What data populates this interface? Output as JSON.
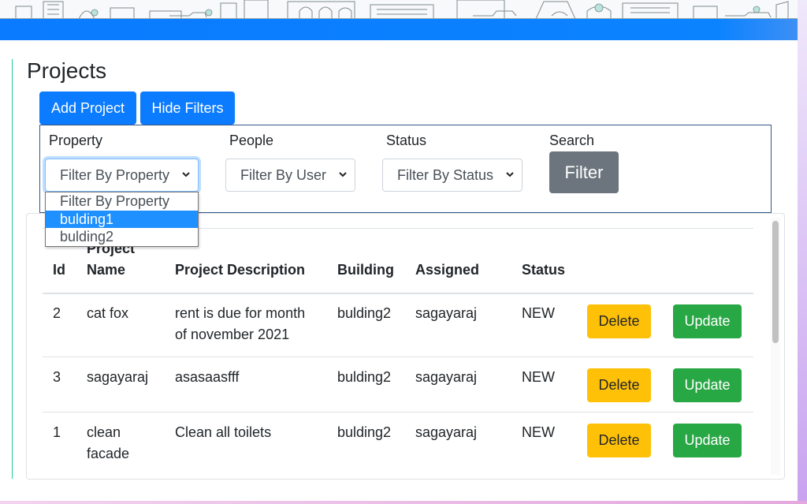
{
  "page": {
    "title": "Projects"
  },
  "toolbar": {
    "add_project_label": "Add Project",
    "hide_filters_label": "Hide Filters"
  },
  "filters": {
    "property_label": "Property",
    "people_label": "People",
    "status_label": "Status",
    "search_label": "Search",
    "property_select_value": "Filter By Property",
    "people_select_value": "Filter By User",
    "status_select_value": "Filter By Status",
    "filter_button_label": "Filter",
    "property_options": [
      "Filter By Property",
      "bulding1",
      "bulding2"
    ],
    "highlighted_option": "bulding1"
  },
  "table": {
    "headers": {
      "id": "Id",
      "name_line1": "Project",
      "name_line2": "Name",
      "description": "Project Description",
      "building": "Building",
      "assigned": "Assigned",
      "status": "Status"
    },
    "rows": [
      {
        "id": "2",
        "name_line1": "cat fox",
        "name_line2": "",
        "desc_line1": "rent is due for month",
        "desc_line2": "of november 2021",
        "building": "bulding2",
        "assigned": "sagayaraj",
        "status": "NEW",
        "delete_label": "Delete",
        "update_label": "Update"
      },
      {
        "id": "3",
        "name_line1": "sagayaraj",
        "name_line2": "",
        "desc_line1": "asasaasfff",
        "desc_line2": "",
        "building": "bulding2",
        "assigned": "sagayaraj",
        "status": "NEW",
        "delete_label": "Delete",
        "update_label": "Update"
      },
      {
        "id": "1",
        "name_line1": "clean",
        "name_line2": "facade",
        "desc_line1": "Clean all toilets",
        "desc_line2": "",
        "building": "bulding2",
        "assigned": "sagayaraj",
        "status": "NEW",
        "delete_label": "Delete",
        "update_label": "Update"
      }
    ]
  },
  "colors": {
    "primary": "#0b7bff",
    "secondary": "#6c757d",
    "warning": "#ffc107",
    "success": "#28a745",
    "accent_rule": "#20c997"
  },
  "icons": {
    "select_arrow": "chevron-down-icon",
    "banner": "city-skyline-illustration"
  }
}
